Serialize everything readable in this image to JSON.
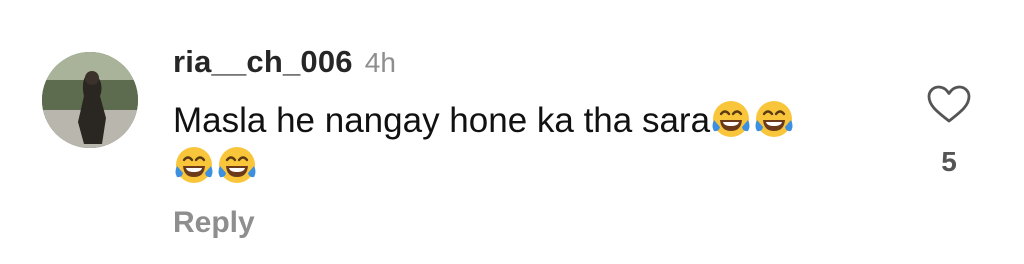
{
  "comment": {
    "username": "ria__ch_006",
    "time": "4h",
    "text": "Masla he nangay hone ka tha sara",
    "emojis": [
      "face-with-tears-of-joy-icon",
      "face-with-tears-of-joy-icon",
      "face-with-tears-of-joy-icon",
      "face-with-tears-of-joy-icon"
    ],
    "reply_label": "Reply",
    "like_count": "5"
  },
  "colors": {
    "username": "#262626",
    "muted": "#8e8e8e",
    "text": "#111111",
    "emoji_face": "#F9C53B",
    "emoji_tears": "#3D8FE0"
  }
}
